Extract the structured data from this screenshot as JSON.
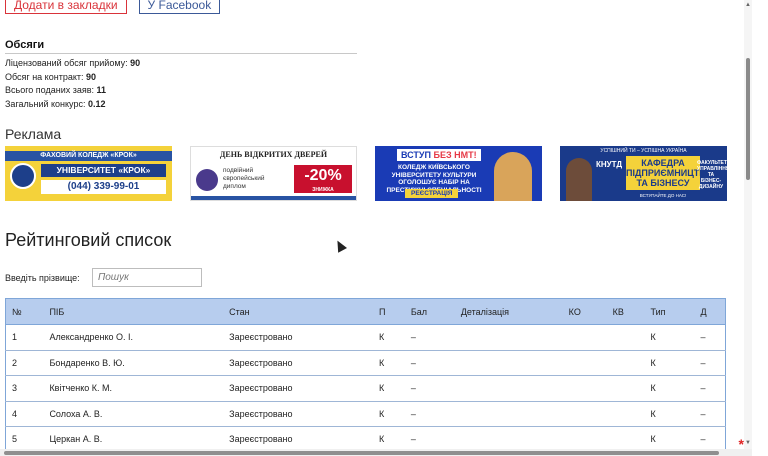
{
  "top_buttons": {
    "bookmark_label": "Додати в закладки",
    "facebook_label": "У Facebook"
  },
  "stats": {
    "title": "Обсяги",
    "rows": [
      {
        "label": "Ліцензований обсяг прийому:",
        "value": "90"
      },
      {
        "label": "Обсяг на контракт:",
        "value": "90"
      },
      {
        "label": "Всього поданих заяв:",
        "value": "11"
      },
      {
        "label": "Загальний конкурс:",
        "value": "0.12"
      }
    ]
  },
  "ads": {
    "title": "Реклама",
    "ad1": {
      "band": "ФАХОВИЙ КОЛЕДЖ «КРОК»",
      "name": "УНІВЕРСИТЕТ «КРОК»",
      "phone": "(044) 339-99-01"
    },
    "ad2": {
      "head": "ДЕНЬ ВІДКРИТИХ ДВЕРЕЙ",
      "sub": "подвійний європейський диплом",
      "discount": "-20%",
      "discount_sub": "ЗНИЖКА"
    },
    "ad3": {
      "tag_a": "ВСТУП ",
      "tag_b": "БЕЗ НМТ!",
      "text": "КОЛЕДЖ КИЇВСЬКОГО УНІВЕРСИТЕТУ КУЛЬТУРИ ОГОЛОШУЄ НАБІР НА ПРЕСТИЖНІ СПЕЦІАЛЬНОСТІ",
      "reg": "РЕЄСТРАЦІЯ"
    },
    "ad4": {
      "top": "УСПІШНИЙ ТИ – УСПІШНА УКРАЇНА",
      "k": "КНУТД",
      "box": "КАФЕДРА ПІДПРИЄМНИЦТВА ТА БІЗНЕСУ",
      "right": "ФАКУЛЬТЕТ УПРАВЛІННЯ ТА БІЗНЕС-ДИЗАЙНУ",
      "bottom": "ВСТУПАЙТЕ ДО НАС!"
    }
  },
  "rating": {
    "title": "Рейтинговий список",
    "search_label": "Введіть прізвище:",
    "search_placeholder": "Пошук"
  },
  "table": {
    "headers": [
      "№",
      "ПІБ",
      "Стан",
      "П",
      "Бал",
      "Деталізація",
      "КО",
      "КВ",
      "Тип",
      "Д"
    ],
    "rows": [
      [
        "1",
        "Александренко О. І.",
        "Зареєстровано",
        "К",
        "–",
        "",
        "",
        "",
        "К",
        "–"
      ],
      [
        "2",
        "Бондаренко В. Ю.",
        "Зареєстровано",
        "К",
        "–",
        "",
        "",
        "",
        "К",
        "–"
      ],
      [
        "3",
        "Квітченко К. М.",
        "Зареєстровано",
        "К",
        "–",
        "",
        "",
        "",
        "К",
        "–"
      ],
      [
        "4",
        "Солоха А. В.",
        "Зареєстровано",
        "К",
        "–",
        "",
        "",
        "",
        "К",
        "–"
      ],
      [
        "5",
        "Церкан А. В.",
        "Зареєстровано",
        "К",
        "–",
        "",
        "",
        "",
        "К",
        "–"
      ]
    ]
  },
  "misc": {
    "required_star": "*",
    "scroll_up": "▲",
    "scroll_down": "▼"
  }
}
